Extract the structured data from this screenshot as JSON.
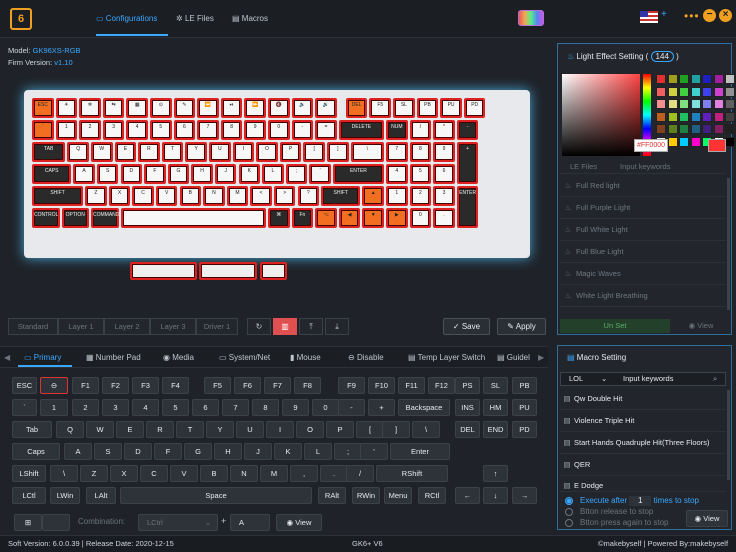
{
  "header": {
    "logo": "6",
    "tabs": [
      {
        "label": "Configurations"
      },
      {
        "label": "LE Files"
      },
      {
        "label": "Macros"
      }
    ]
  },
  "device": {
    "model_label": "Model:",
    "model_value": "GK96XS-RGB",
    "firmware_label": "Firm Version:",
    "firmware_value": "v1.10"
  },
  "layers": [
    "Standard",
    "Layer 1",
    "Layer 2",
    "Layer 3",
    "Driver 1"
  ],
  "actions": {
    "save": "Save",
    "apply": "Apply"
  },
  "keyboard_preview": {
    "row0": [
      "ESC",
      "☀",
      "✲",
      "⇆",
      "▦",
      "⊙",
      "✎",
      "⏪",
      "⏯",
      "⏩",
      "🔇",
      "🔉",
      "🔊",
      "DEL",
      "F5",
      "SL",
      "PB",
      "PU",
      "PD"
    ],
    "row1": [
      "`",
      "1",
      "2",
      "3",
      "4",
      "5",
      "6",
      "7",
      "8",
      "9",
      "0",
      "-",
      "=",
      "DELETE",
      "NUM",
      "/",
      "*",
      "-"
    ],
    "row2": [
      "TAB",
      "Q",
      "W",
      "E",
      "R",
      "T",
      "Y",
      "U",
      "I",
      "O",
      "P",
      "[",
      "]",
      "\\",
      "7",
      "8",
      "9",
      "+"
    ],
    "row3": [
      "CAPS",
      "A",
      "S",
      "D",
      "F",
      "G",
      "H",
      "J",
      "K",
      "L",
      ";",
      "'",
      "ENTER",
      "4",
      "5",
      "6"
    ],
    "row4": [
      "SHIFT",
      "Z",
      "X",
      "C",
      "V",
      "B",
      "N",
      "M",
      "<",
      ">",
      "?",
      "SHIFT",
      "▲",
      "1",
      "2",
      "3",
      "ENTER"
    ],
    "row5": [
      "CONTROL",
      "OPTION",
      "COMMAND",
      "",
      "⌘",
      "Fn",
      "⌥",
      "◀",
      "▼",
      "▶",
      "0",
      "."
    ]
  },
  "key_tabs": [
    {
      "label": "Primary"
    },
    {
      "label": "Number Pad"
    },
    {
      "label": "Media"
    },
    {
      "label": "System/Net"
    },
    {
      "label": "Mouse"
    },
    {
      "label": "Disable"
    },
    {
      "label": "Temp Layer Switch"
    },
    {
      "label": "Guidel"
    }
  ],
  "primary_keys": {
    "r0": [
      "ESC",
      "⊖",
      "F1",
      "F2",
      "F3",
      "F4",
      "F5",
      "F6",
      "F7",
      "F8",
      "F9",
      "F10",
      "F11",
      "F12",
      "PS",
      "SL",
      "PB"
    ],
    "r1": [
      "`",
      "1",
      "2",
      "3",
      "4",
      "5",
      "6",
      "7",
      "8",
      "9",
      "0",
      "-",
      "+",
      "Backspace",
      "INS",
      "HM",
      "PU"
    ],
    "r2": [
      "Tab",
      "Q",
      "W",
      "E",
      "R",
      "T",
      "Y",
      "U",
      "I",
      "O",
      "P",
      "[",
      "]",
      "\\",
      "DEL",
      "END",
      "PD"
    ],
    "r3": [
      "Caps",
      "A",
      "S",
      "D",
      "F",
      "G",
      "H",
      "J",
      "K",
      "L",
      ";",
      "'",
      "Enter"
    ],
    "r4": [
      "LShift",
      "\\",
      "Z",
      "X",
      "C",
      "V",
      "B",
      "N",
      "M",
      ",",
      ".",
      "/",
      "RShift",
      "↑"
    ],
    "r5": [
      "LCtl",
      "LWin",
      "LAlt",
      "Space",
      "RAlt",
      "RWin",
      "Menu",
      "RCtl",
      "←",
      "↓",
      "→"
    ]
  },
  "combination": {
    "label": "Combination:",
    "select_value": "LCtrl",
    "plus": "+",
    "key_value": "A",
    "view": "View"
  },
  "light_effect": {
    "title": "Light Effect Setting (",
    "count": "144",
    "title_end": ")",
    "hex": "#FF0000",
    "tabs": [
      "LE Files",
      "Input keywords"
    ],
    "items": [
      "Full Red light",
      "Full Purple Light",
      "Full White Light",
      "Full Blue Light",
      "Magic Waves",
      "White Light Breathing"
    ],
    "unset": "Un Set",
    "view": "View",
    "swatches": [
      "#e03030",
      "#a0a020",
      "#20a020",
      "#20a0a0",
      "#2020c0",
      "#a020a0",
      "#c0c0c0",
      "#f06060",
      "#d0d040",
      "#40d040",
      "#40d0d0",
      "#4040f0",
      "#d040d0",
      "#909090",
      "#f09090",
      "#e0e080",
      "#80e080",
      "#80e0e0",
      "#8080f0",
      "#e080e0",
      "#606060",
      "#c06020",
      "#a0c020",
      "#20c060",
      "#2080c0",
      "#6020c0",
      "#c02080",
      "#404040",
      "#804020",
      "#608020",
      "#208040",
      "#206080",
      "#402080",
      "#802060",
      "#202020",
      "#f0f0f0",
      "#ffcc00",
      "#00ccff",
      "#ff00cc",
      "#00ff66",
      "#ffffff",
      "#000000"
    ]
  },
  "macro": {
    "title": "Macro Setting",
    "select_value": "LOL",
    "search_placeholder": "Input keywords",
    "items": [
      "Qw Double Hit",
      "Violence Triple Hit",
      "Start Hands Quadruple Hit(Three Floors)",
      "QER",
      "E Dodge"
    ],
    "opt1_prefix": "Execute after",
    "opt1_value": "1",
    "opt1_suffix": "times to stop",
    "opt2": "Btton release to stop",
    "opt3": "Btton press again to stop",
    "view": "View"
  },
  "footer": {
    "soft_version": "Soft Version: 6.0.0.39  |  Release Date: 2020-12-15",
    "center": "GK6+ V6",
    "right": "©makebyself  |  Powered By:makebyself"
  }
}
